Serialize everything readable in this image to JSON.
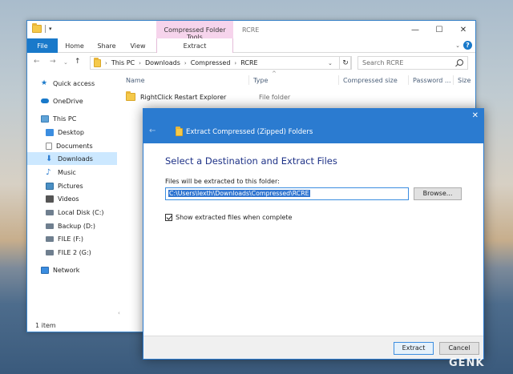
{
  "explorer": {
    "title": "RCRE",
    "context_tab_group": "Compressed Folder Tools",
    "ribbon_tabs": [
      "File",
      "Home",
      "Share",
      "View",
      "Extract"
    ],
    "breadcrumb": [
      "This PC",
      "Downloads",
      "Compressed",
      "RCRE"
    ],
    "search_placeholder": "Search RCRE",
    "nav_items": [
      {
        "label": "Quick access",
        "icon": "star-icon",
        "color": "#1979ca"
      },
      {
        "label": "OneDrive",
        "icon": "cloud-icon",
        "color": "#1979ca"
      },
      {
        "label": "This PC",
        "icon": "computer-icon",
        "color": "#5fa3d8"
      },
      {
        "label": "Desktop",
        "icon": "desktop-icon",
        "color": "#3b8de0"
      },
      {
        "label": "Documents",
        "icon": "documents-icon",
        "color": "#8d8d8d"
      },
      {
        "label": "Downloads",
        "icon": "downloads-icon",
        "color": "#2b7bd0",
        "selected": true
      },
      {
        "label": "Music",
        "icon": "music-icon",
        "color": "#2b7bd0"
      },
      {
        "label": "Pictures",
        "icon": "pictures-icon",
        "color": "#4a8fc4"
      },
      {
        "label": "Videos",
        "icon": "videos-icon",
        "color": "#555555"
      },
      {
        "label": "Local Disk (C:)",
        "icon": "drive-icon",
        "color": "#6f7f8f"
      },
      {
        "label": "Backup (D:)",
        "icon": "drive-icon",
        "color": "#6f7f8f"
      },
      {
        "label": "FILE (F:)",
        "icon": "drive-icon",
        "color": "#6f7f8f"
      },
      {
        "label": "FILE 2 (G:)",
        "icon": "drive-icon",
        "color": "#6f7f8f"
      },
      {
        "label": "Network",
        "icon": "network-icon",
        "color": "#3b8de0"
      }
    ],
    "columns": [
      "Name",
      "Type",
      "Compressed size",
      "Password ...",
      "Size"
    ],
    "files": [
      {
        "name": "RightClick Restart Explorer",
        "type": "File folder"
      }
    ],
    "status": "1 item"
  },
  "dialog": {
    "title": "Extract Compressed (Zipped) Folders",
    "heading": "Select a Destination and Extract Files",
    "label": "Files will be extracted to this folder:",
    "path": "C:\\Users\\lexth\\Downloads\\Compressed\\RCRE",
    "browse": "Browse...",
    "checkbox_label": "Show extracted files when complete",
    "checkbox_checked": true,
    "extract": "Extract",
    "cancel": "Cancel"
  },
  "watermark": "GENK"
}
